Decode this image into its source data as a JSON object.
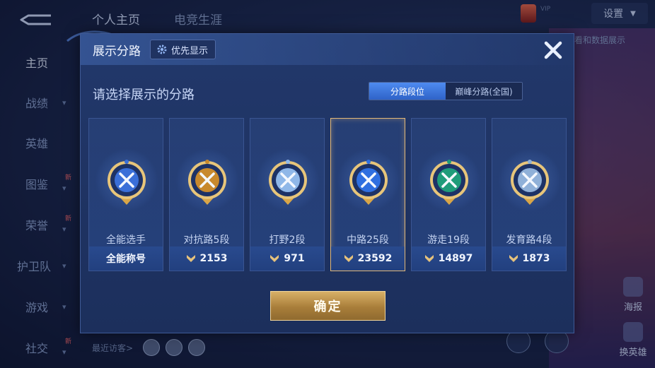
{
  "background": {
    "top_tabs": [
      "个人主页",
      "电竞生涯"
    ],
    "settings_label": "设置",
    "data_show_label": "看和数据展示",
    "vip_label": "VIP",
    "sidebar": [
      {
        "label": "主页",
        "chevron": false,
        "new": false
      },
      {
        "label": "战绩",
        "chevron": true,
        "new": false
      },
      {
        "label": "英雄",
        "chevron": false,
        "new": false
      },
      {
        "label": "图鉴",
        "chevron": true,
        "new": true
      },
      {
        "label": "荣誉",
        "chevron": true,
        "new": true
      },
      {
        "label": "护卫队",
        "chevron": true,
        "new": false
      },
      {
        "label": "游戏",
        "chevron": true,
        "new": false
      },
      {
        "label": "社交",
        "chevron": true,
        "new": true
      }
    ],
    "new_label": "新",
    "recent_visitors_label": "最近访客>",
    "right_buttons": [
      "海报",
      "换英雄"
    ]
  },
  "modal": {
    "title": "展示分路",
    "priority_label": "优先显示",
    "subtitle": "请选择展示的分路",
    "toggle": {
      "active": "分路段位",
      "inactive": "巅峰分路(全国)"
    },
    "cards": [
      {
        "name": "全能选手",
        "value": "全能称号",
        "show_arrow": false,
        "selected": false,
        "accent": "#3a6fd8"
      },
      {
        "name": "对抗路5段",
        "value": "2153",
        "show_arrow": true,
        "selected": false,
        "accent": "#c8892d"
      },
      {
        "name": "打野2段",
        "value": "971",
        "show_arrow": true,
        "selected": false,
        "accent": "#8fb7e8"
      },
      {
        "name": "中路25段",
        "value": "23592",
        "show_arrow": true,
        "selected": true,
        "accent": "#2f6fe0"
      },
      {
        "name": "游走19段",
        "value": "14897",
        "show_arrow": true,
        "selected": false,
        "accent": "#1f9c7a"
      },
      {
        "name": "发育路4段",
        "value": "1873",
        "show_arrow": true,
        "selected": false,
        "accent": "#8fb0d8"
      }
    ],
    "confirm_label": "确定"
  }
}
